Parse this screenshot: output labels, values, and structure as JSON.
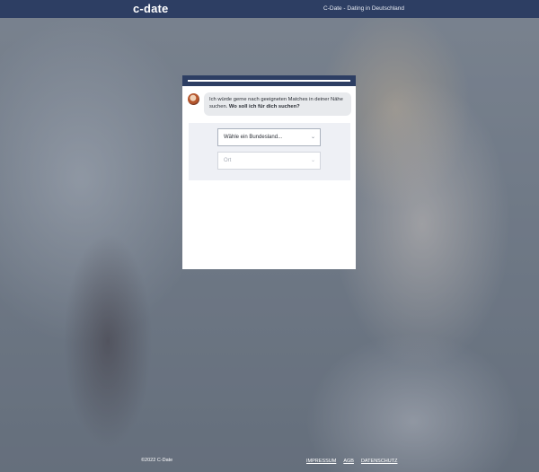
{
  "header": {
    "logo": "c-date",
    "tagline": "C-Date - Dating in Deutschland"
  },
  "card": {
    "progress": 0.15,
    "message_regular": "Ich würde gerne nach geeigneten Matches in deiner Nähe suchen.",
    "message_bold": "Wo soll ich für dich suchen?",
    "state_select": {
      "placeholder": "Wähle ein Bundesland..."
    },
    "city_select": {
      "placeholder": "Ort"
    }
  },
  "footer": {
    "copyright": "©2022 C-Date",
    "links": [
      "IMPRESSUM",
      "AGB",
      "DATENSCHUTZ"
    ]
  },
  "icons": {
    "chevron": "chevron-down-icon"
  },
  "colors": {
    "brand_navy": "#2d3e63",
    "bubble_bg": "#e8eaed",
    "form_bg": "#eef0f5"
  }
}
